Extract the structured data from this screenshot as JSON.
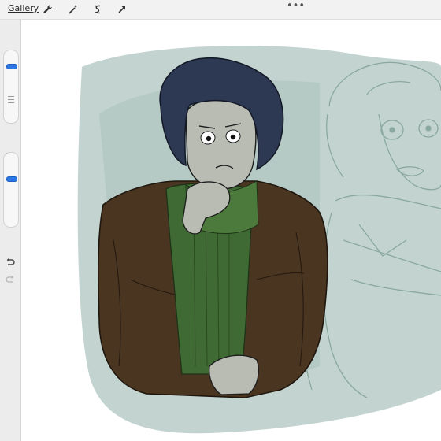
{
  "topbar": {
    "gallery_label": "Gallery",
    "tools": [
      "wrench-icon",
      "magic-wand-icon",
      "selection-icon",
      "transform-arrow-icon"
    ],
    "more_glyph": "•••"
  },
  "sidebar": {
    "brush_size_level": 0.2,
    "opacity_level": 0.35,
    "modify_icon": "square-icon",
    "undo_icon": "undo-icon",
    "redo_icon": "redo-icon"
  },
  "colors": {
    "bar": "#f2f2f2",
    "accent": "#2b78e4",
    "wash": "#b9cdc8",
    "jacket": "#4a3520",
    "sweater": "#3f6a33",
    "hair": "#2d3852",
    "skin": "#b8bcb3"
  }
}
